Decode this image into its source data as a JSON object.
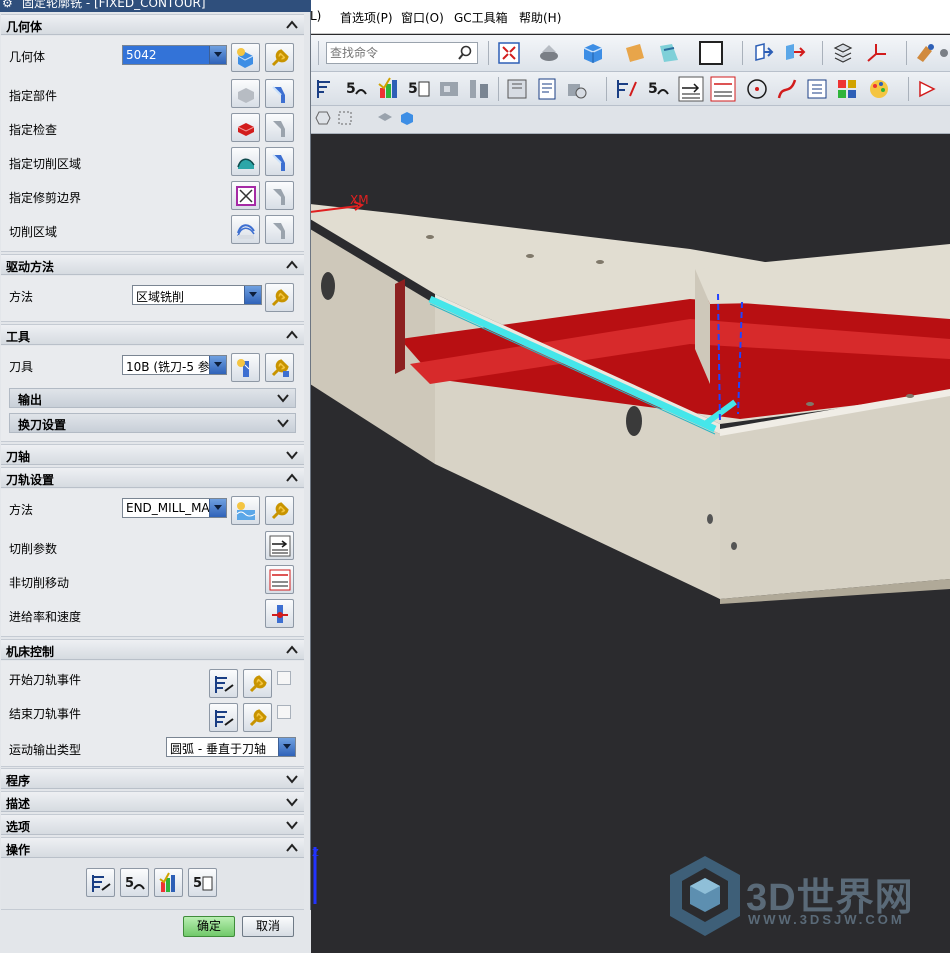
{
  "window": {
    "title": "固定轮廓铣 - [FIXED_CONTOUR]"
  },
  "menu": {
    "items": [
      "L)",
      "首选项(P)",
      "窗口(O)",
      "GC工具箱",
      "帮助(H)"
    ]
  },
  "search": {
    "placeholder": "查找命令"
  },
  "sections": {
    "geometry": {
      "title": "几何体",
      "geometry_label": "几何体",
      "geometry_value": "5042",
      "specify_part": "指定部件",
      "specify_check": "指定检查",
      "specify_cut_area": "指定切削区域",
      "specify_trim": "指定修剪边界",
      "cut_region": "切削区域"
    },
    "drive": {
      "title": "驱动方法",
      "method_label": "方法",
      "method_value": "区域铣削"
    },
    "tool": {
      "title": "工具",
      "tool_label": "刀具",
      "tool_value": "10B (铣刀-5 参",
      "output": "输出",
      "tool_change": "换刀设置"
    },
    "axis": {
      "title": "刀轴"
    },
    "path": {
      "title": "刀轨设置",
      "method_label": "方法",
      "method_value": "END_MILL_MA",
      "cut_params": "切削参数",
      "non_cut_moves": "非切削移动",
      "feeds_speeds": "进给率和速度"
    },
    "machine": {
      "title": "机床控制",
      "start_events": "开始刀轨事件",
      "end_events": "结束刀轨事件",
      "motion_output_label": "运动输出类型",
      "motion_output_value": "圆弧 - 垂直于刀轴"
    },
    "program": {
      "title": "程序"
    },
    "description": {
      "title": "描述"
    },
    "options": {
      "title": "选项"
    },
    "actions": {
      "title": "操作"
    }
  },
  "buttons": {
    "ok": "确定",
    "cancel": "取消"
  },
  "viewport": {
    "axis_label_xm": "XM",
    "axis_label_z": "Z",
    "watermark_big": "3D世界网",
    "watermark_small": "WWW.3DSJW.COM"
  },
  "colors": {
    "part_face": "#e1ddd1",
    "part_shadow": "#b9b2a2",
    "pocket_red": "#b80f12",
    "toolpath_cyan": "#45e6ea",
    "select_blue": "#3373d8",
    "ok_green": "#71c96a"
  },
  "icons": {
    "wrench": "wrench-icon",
    "flashlight": "flashlight-icon",
    "dropdown": "chevron-down-icon"
  }
}
